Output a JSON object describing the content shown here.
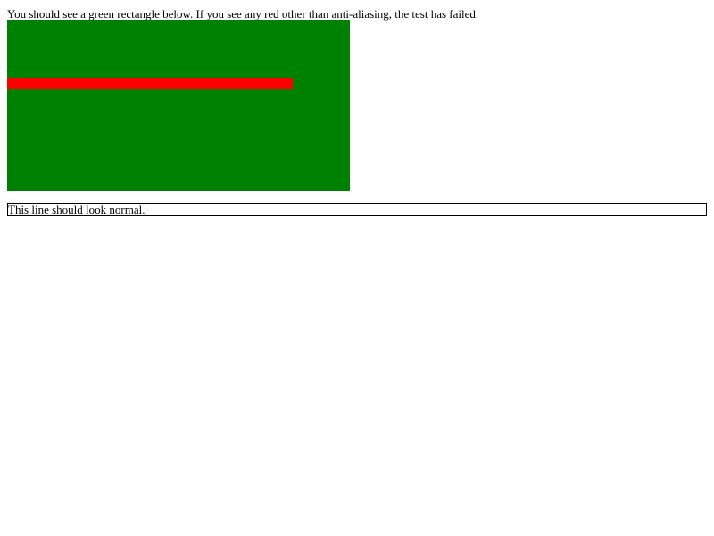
{
  "instruction_text": "You should see a green rectangle below. If you see any red other than anti-aliasing, the test has failed.",
  "normal_line_text": "This line should look normal.",
  "colors": {
    "green_rect": "#008000",
    "red_bar": "#ff0000",
    "border": "#000000",
    "background": "#ffffff"
  }
}
